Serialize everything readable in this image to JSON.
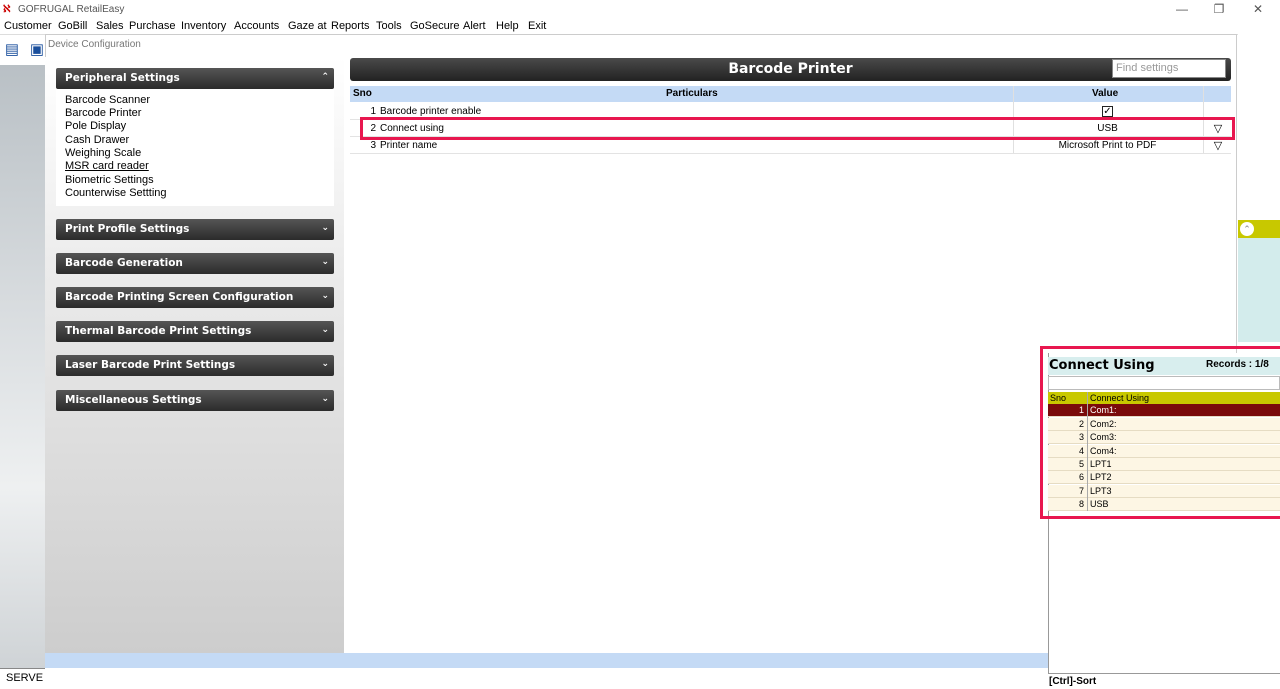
{
  "window": {
    "title": "GOFRUGAL RetailEasy",
    "minimize": "—",
    "maximize": "❐",
    "close": "✕"
  },
  "menu": [
    "Customer",
    "GoBill",
    "Sales",
    "Purchase",
    "Inventory",
    "Accounts",
    "Gaze at",
    "Reports",
    "Tools",
    "GoSecure",
    "Alert",
    "Help",
    "Exit"
  ],
  "status": {
    "server": "SERVE"
  },
  "dialog": {
    "title": "Device Configuration"
  },
  "sidebar": {
    "peripheral": {
      "label": "Peripheral Settings",
      "items": [
        "Barcode Scanner",
        "Barcode Printer",
        "Pole Display",
        "Cash Drawer",
        "Weighing Scale",
        "MSR card reader",
        "Biometric Settings",
        "Counterwise Settting"
      ]
    },
    "sections": [
      "Print Profile Settings",
      "Barcode Generation",
      "Barcode Printing Screen Configuration",
      "Thermal Barcode Print Settings",
      "Laser Barcode Print Settings",
      "Miscellaneous Settings"
    ]
  },
  "main": {
    "title": "Barcode Printer",
    "search_placeholder": "Find settings",
    "columns": {
      "sno": "Sno",
      "particulars": "Particulars",
      "value": "Value"
    },
    "rows": [
      {
        "sno": "1",
        "particular": "Barcode printer enable",
        "value": "☑",
        "checked": true
      },
      {
        "sno": "2",
        "particular": "Connect using",
        "value": "USB",
        "dropdown": "▽"
      },
      {
        "sno": "3",
        "particular": "Printer name",
        "value": "Microsoft Print to PDF",
        "dropdown": "▽"
      }
    ]
  },
  "connect_using": {
    "title": "Connect Using",
    "records": "Records : 1/8",
    "columns": {
      "sno": "Sno",
      "name": "Connect Using"
    },
    "items": [
      {
        "n": "1",
        "v": "Com1:"
      },
      {
        "n": "2",
        "v": "Com2:"
      },
      {
        "n": "3",
        "v": "Com3:"
      },
      {
        "n": "4",
        "v": "Com4:"
      },
      {
        "n": "5",
        "v": "LPT1"
      },
      {
        "n": "6",
        "v": "LPT2"
      },
      {
        "n": "7",
        "v": "LPT3"
      },
      {
        "n": "8",
        "v": "USB"
      }
    ],
    "selected_index": 0,
    "footer": "[Ctrl]-Sort"
  },
  "colors": {
    "highlight": "#e8174f",
    "selected_row": "#7a0b0b",
    "header_blue": "#c4daf5",
    "olive": "#c8c800"
  }
}
